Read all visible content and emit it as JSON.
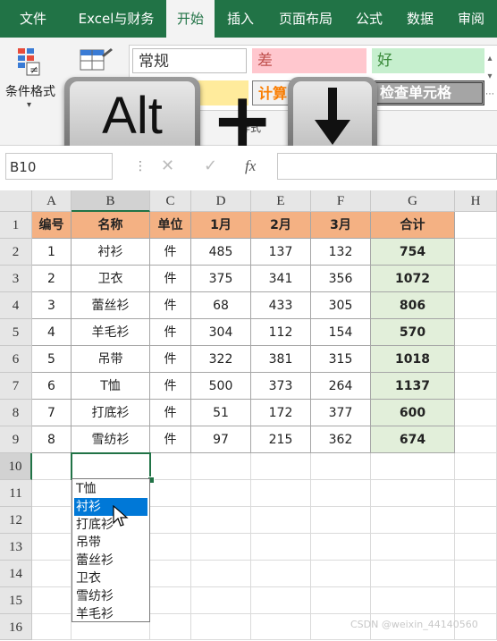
{
  "tabs": [
    "文件",
    "Excel与财务",
    "开始",
    "插入",
    "页面布局",
    "公式",
    "数据",
    "审阅"
  ],
  "active_tab": "开始",
  "ribbon": {
    "conditional_format_label": "条件格式",
    "styles_group_label": "样式",
    "style_normal": "常规",
    "style_bad": "差",
    "style_good": "好",
    "style_calc": "计算",
    "style_check": "检查单元格"
  },
  "keys": {
    "alt": "Alt",
    "plus": "+",
    "down_arrow": "↓"
  },
  "formula_bar": {
    "name_box": "B10",
    "fx": "fx"
  },
  "columns": [
    "A",
    "B",
    "C",
    "D",
    "E",
    "F",
    "G",
    "H"
  ],
  "rows": [
    "1",
    "2",
    "3",
    "4",
    "5",
    "6",
    "7",
    "8",
    "9",
    "10",
    "11",
    "12",
    "13",
    "14",
    "15",
    "16"
  ],
  "table": {
    "headers": [
      "编号",
      "名称",
      "单位",
      "1月",
      "2月",
      "3月",
      "合计"
    ],
    "rows": [
      [
        "1",
        "衬衫",
        "件",
        "485",
        "137",
        "132",
        "754"
      ],
      [
        "2",
        "卫衣",
        "件",
        "375",
        "341",
        "356",
        "1072"
      ],
      [
        "3",
        "蕾丝衫",
        "件",
        "68",
        "433",
        "305",
        "806"
      ],
      [
        "4",
        "羊毛衫",
        "件",
        "304",
        "112",
        "154",
        "570"
      ],
      [
        "5",
        "吊带",
        "件",
        "322",
        "381",
        "315",
        "1018"
      ],
      [
        "6",
        "T恤",
        "件",
        "500",
        "373",
        "264",
        "1137"
      ],
      [
        "7",
        "打底衫",
        "件",
        "51",
        "172",
        "377",
        "600"
      ],
      [
        "8",
        "雪纺衫",
        "件",
        "97",
        "215",
        "362",
        "674"
      ]
    ]
  },
  "dropdown": {
    "items": [
      "T恤",
      "衬衫",
      "打底衫",
      "吊带",
      "蕾丝衫",
      "卫衣",
      "雪纺衫",
      "羊毛衫"
    ],
    "selected_index": 1
  },
  "watermark": "CSDN @weixin_44140560",
  "colors": {
    "excel_green": "#217346",
    "header_fill": "#f4b183",
    "sum_fill": "#e2efda",
    "selection": "#0078d7"
  }
}
